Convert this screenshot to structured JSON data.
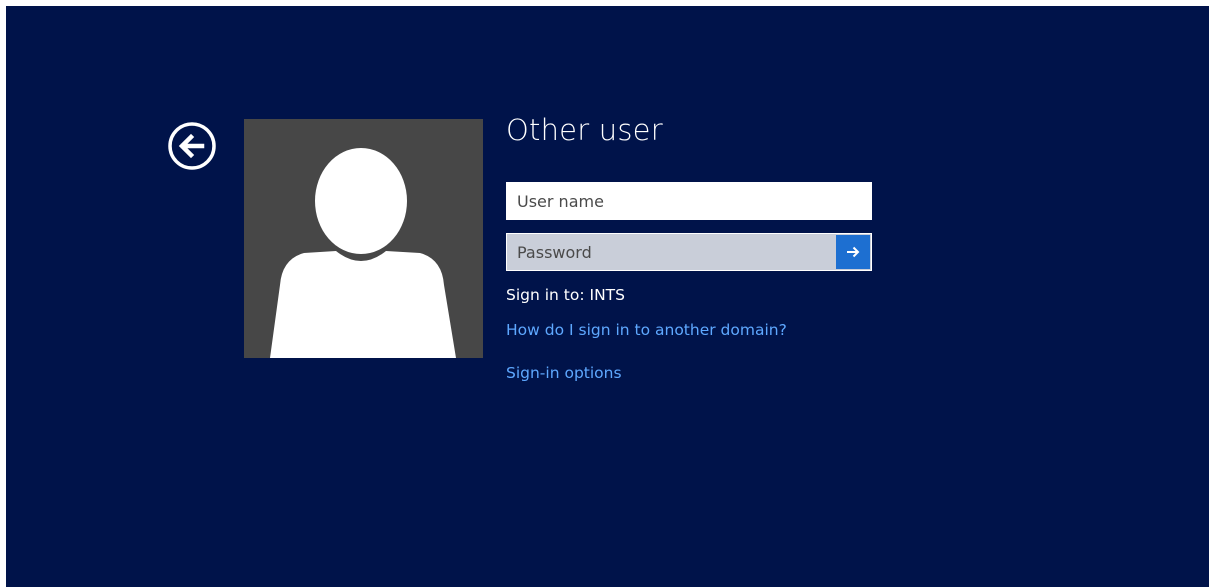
{
  "page": {
    "title": "Other user"
  },
  "form": {
    "username_placeholder": "User name",
    "username_value": "",
    "password_placeholder": "Password",
    "password_value": "",
    "sign_in_to": "Sign in to: INTS"
  },
  "links": {
    "other_domain": "How do I sign in to another domain?",
    "sign_in_options": "Sign-in options"
  },
  "icons": {
    "back": "back-arrow-circle-icon",
    "submit": "arrow-right-icon",
    "avatar": "user-silhouette-icon"
  },
  "colors": {
    "background": "#00134a",
    "avatar_tile": "#474747",
    "submit_button": "#1d6fd1",
    "link": "#5ea8ff",
    "password_field": "#c9ced9"
  }
}
